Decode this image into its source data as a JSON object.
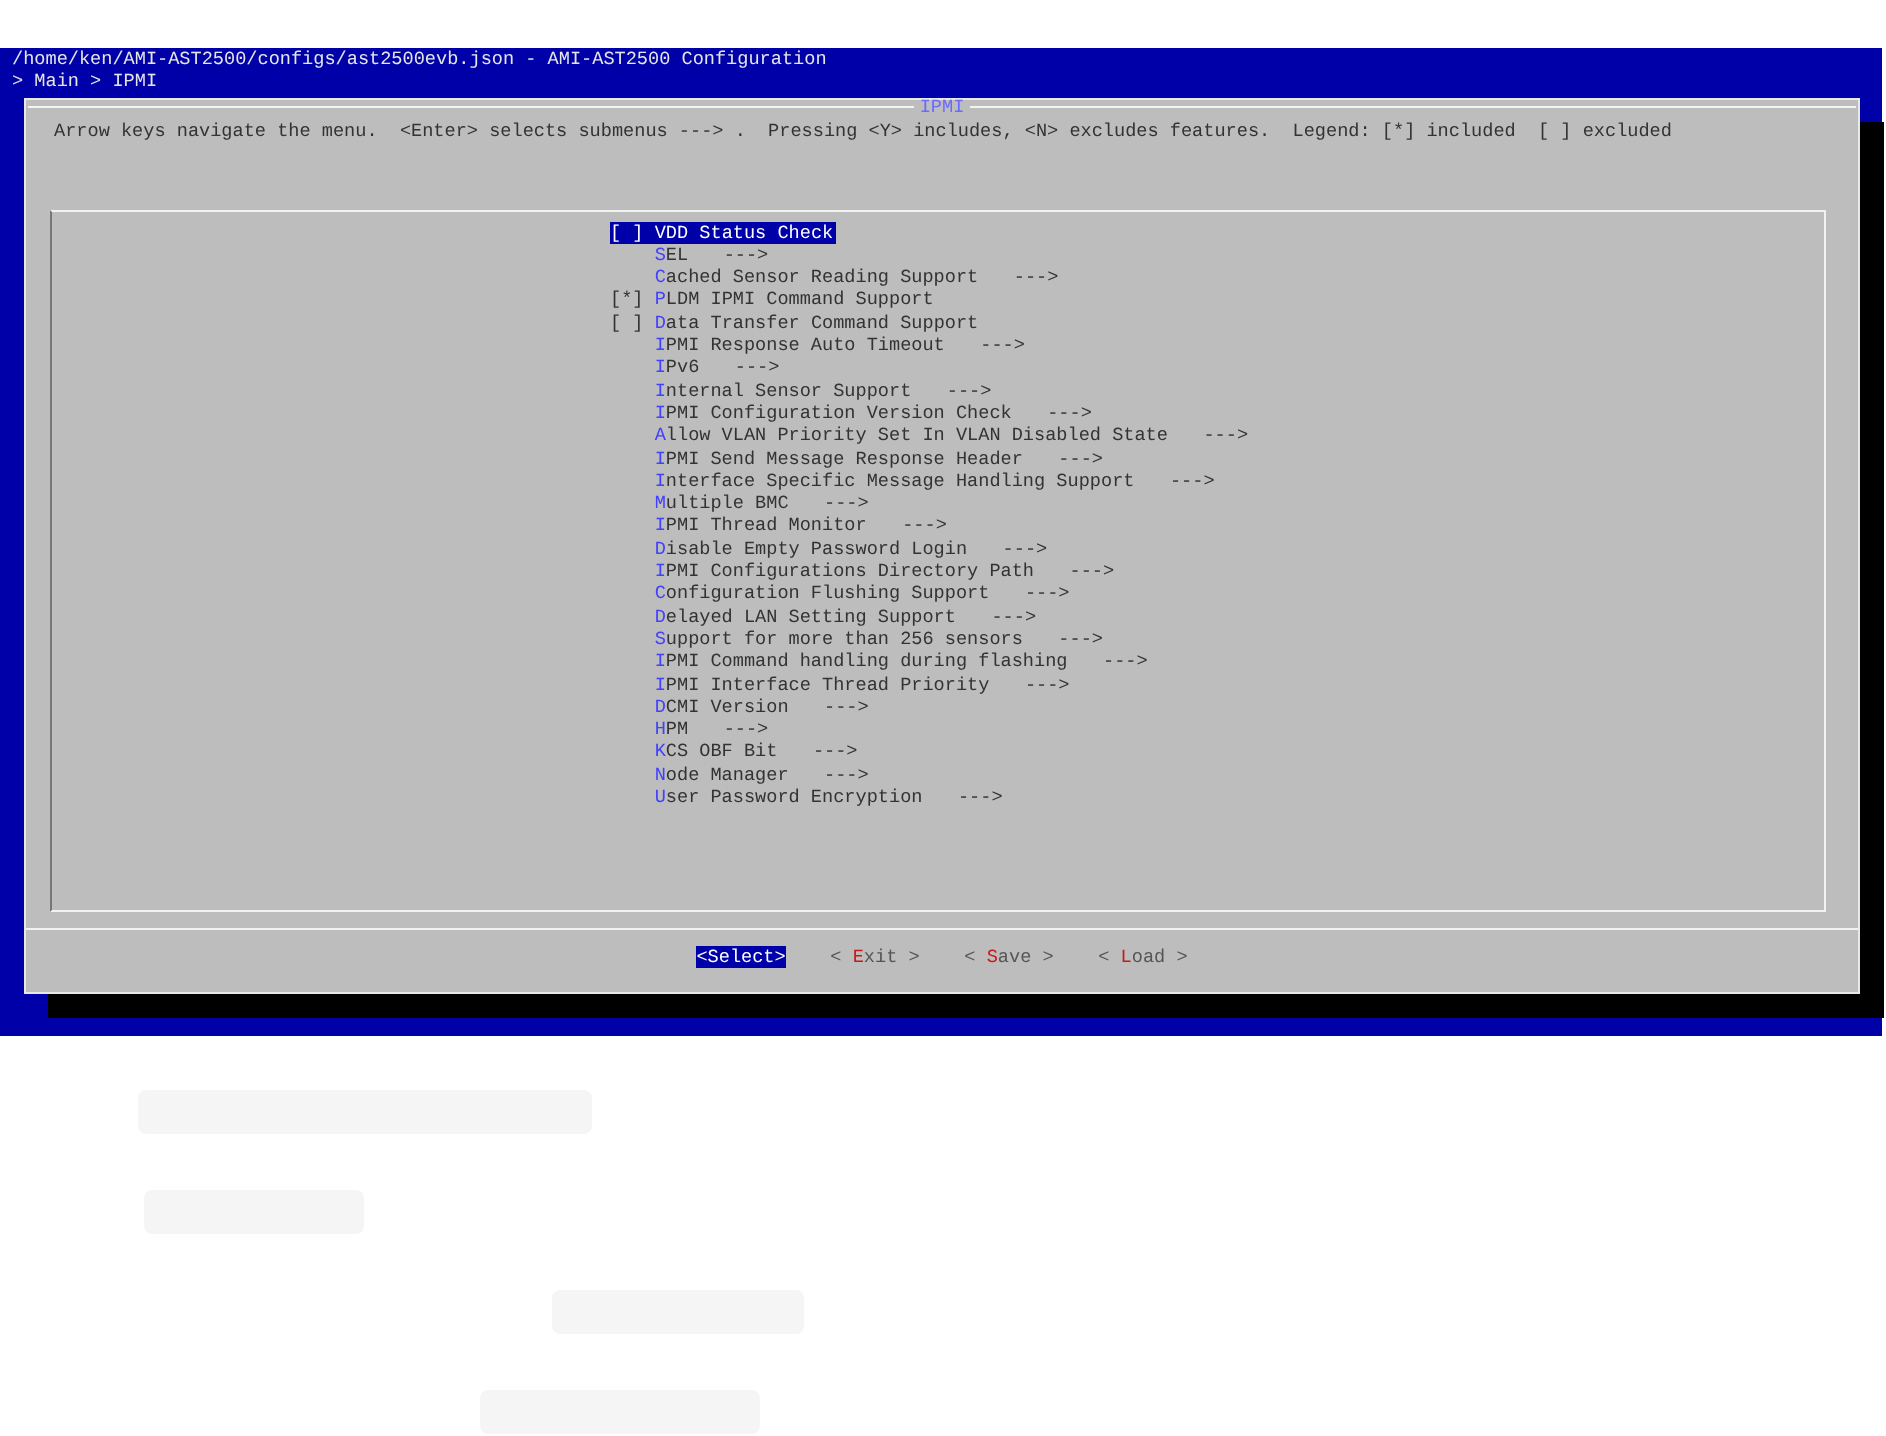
{
  "screen": {
    "title": "/home/ken/AMI-AST2500/configs/ast2500evb.json - AMI-AST2500 Configuration",
    "breadcrumb": "> Main > IPMI"
  },
  "dialog": {
    "title": "IPMI",
    "help": "Arrow keys navigate the menu.  <Enter> selects submenus ---> .  Pressing <Y> includes, <N> excludes features.  Legend: [*] included  [ ] excluded",
    "items": [
      {
        "kind": "bool",
        "box": "[ ]",
        "label": "VDD Status Check",
        "selected": true
      },
      {
        "kind": "menu",
        "label": "SEL",
        "arrow": "--->",
        "selected": false
      },
      {
        "kind": "menu",
        "label": "Cached Sensor Reading Support",
        "arrow": "--->",
        "selected": false
      },
      {
        "kind": "bool",
        "box": "[*]",
        "label": "PLDM IPMI Command Support",
        "selected": false
      },
      {
        "kind": "bool",
        "box": "[ ]",
        "label": "Data Transfer Command Support",
        "selected": false
      },
      {
        "kind": "menu",
        "label": "IPMI Response Auto Timeout",
        "arrow": "--->",
        "selected": false
      },
      {
        "kind": "menu",
        "label": "IPv6",
        "arrow": "--->",
        "selected": false
      },
      {
        "kind": "menu",
        "label": "Internal Sensor Support",
        "arrow": "--->",
        "selected": false
      },
      {
        "kind": "menu",
        "label": "IPMI Configuration Version Check",
        "arrow": "--->",
        "selected": false
      },
      {
        "kind": "menu",
        "label": "Allow VLAN Priority Set In VLAN Disabled State",
        "arrow": "--->",
        "selected": false
      },
      {
        "kind": "menu",
        "label": "IPMI Send Message Response Header",
        "arrow": "--->",
        "selected": false
      },
      {
        "kind": "menu",
        "label": "Interface Specific Message Handling Support",
        "arrow": "--->",
        "selected": false
      },
      {
        "kind": "menu",
        "label": "Multiple BMC",
        "arrow": "--->",
        "selected": false
      },
      {
        "kind": "menu",
        "label": "IPMI Thread Monitor",
        "arrow": "--->",
        "selected": false
      },
      {
        "kind": "menu",
        "label": "Disable Empty Password Login",
        "arrow": "--->",
        "selected": false
      },
      {
        "kind": "menu",
        "label": "IPMI Configurations Directory Path",
        "arrow": "--->",
        "selected": false
      },
      {
        "kind": "menu",
        "label": "Configuration Flushing Support",
        "arrow": "--->",
        "selected": false
      },
      {
        "kind": "menu",
        "label": "Delayed LAN Setting Support",
        "arrow": "--->",
        "selected": false
      },
      {
        "kind": "menu",
        "label": "Support for more than 256 sensors",
        "arrow": "--->",
        "selected": false
      },
      {
        "kind": "menu",
        "label": "IPMI Command handling during flashing",
        "arrow": "--->",
        "selected": false
      },
      {
        "kind": "menu",
        "label": "IPMI Interface Thread Priority",
        "arrow": "--->",
        "selected": false
      },
      {
        "kind": "menu",
        "label": "DCMI Version",
        "arrow": "--->",
        "selected": false
      },
      {
        "kind": "menu",
        "label": "HPM",
        "arrow": "--->",
        "selected": false
      },
      {
        "kind": "menu",
        "label": "KCS OBF Bit",
        "arrow": "--->",
        "selected": false
      },
      {
        "kind": "menu",
        "label": "Node Manager",
        "arrow": "--->",
        "selected": false
      },
      {
        "kind": "menu",
        "label": "User Password Encryption",
        "arrow": "--->",
        "selected": false
      }
    ],
    "buttons": [
      {
        "label": "<Select>",
        "selected": true
      },
      {
        "label": "< Exit >",
        "selected": false
      },
      {
        "label": "< Save >",
        "selected": false
      },
      {
        "label": "< Load >",
        "selected": false
      }
    ]
  }
}
